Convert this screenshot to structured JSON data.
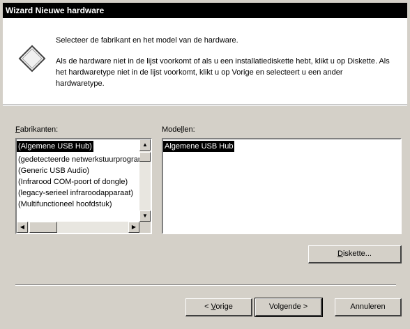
{
  "window": {
    "title": "Wizard Nieuwe hardware"
  },
  "header": {
    "intro": "Selecteer de fabrikant en het model van de hardware.",
    "details": "Als de hardware niet in de lijst voorkomt of als u een installatiediskette hebt, klikt u op Diskette. Als het hardwaretype niet in de lijst voorkomt, klikt u op Vorige en selecteert u een ander hardwaretype."
  },
  "manufacturers": {
    "label_prefix": "",
    "label_accel": "F",
    "label_rest": "abrikanten:",
    "items": [
      "(Algemene USB Hub)",
      "(gedetecteerde netwerkstuurprogramma's)",
      "(Generic USB Audio)",
      "(Infrarood COM-poort of dongle)",
      "(legacy-serieel infraroodapparaat)",
      "(Multifunctioneel hoofdstuk)"
    ],
    "selected_index": 0
  },
  "models": {
    "label_prefix": "Mode",
    "label_accel": "l",
    "label_rest": "len:",
    "items": [
      "Algemene USB Hub"
    ],
    "selected_index": 0
  },
  "buttons": {
    "diskette": {
      "accel": "D",
      "rest": "iskette..."
    },
    "back": {
      "prefix": "< ",
      "accel": "V",
      "rest": "orige"
    },
    "next": {
      "label": "Volgende >"
    },
    "cancel": {
      "label": "Annuleren"
    }
  },
  "icons": {
    "header": "diamond-hardware-icon",
    "scroll_up": "arrow-up-icon",
    "scroll_down": "arrow-down-icon",
    "scroll_left": "arrow-left-icon",
    "scroll_right": "arrow-right-icon"
  }
}
